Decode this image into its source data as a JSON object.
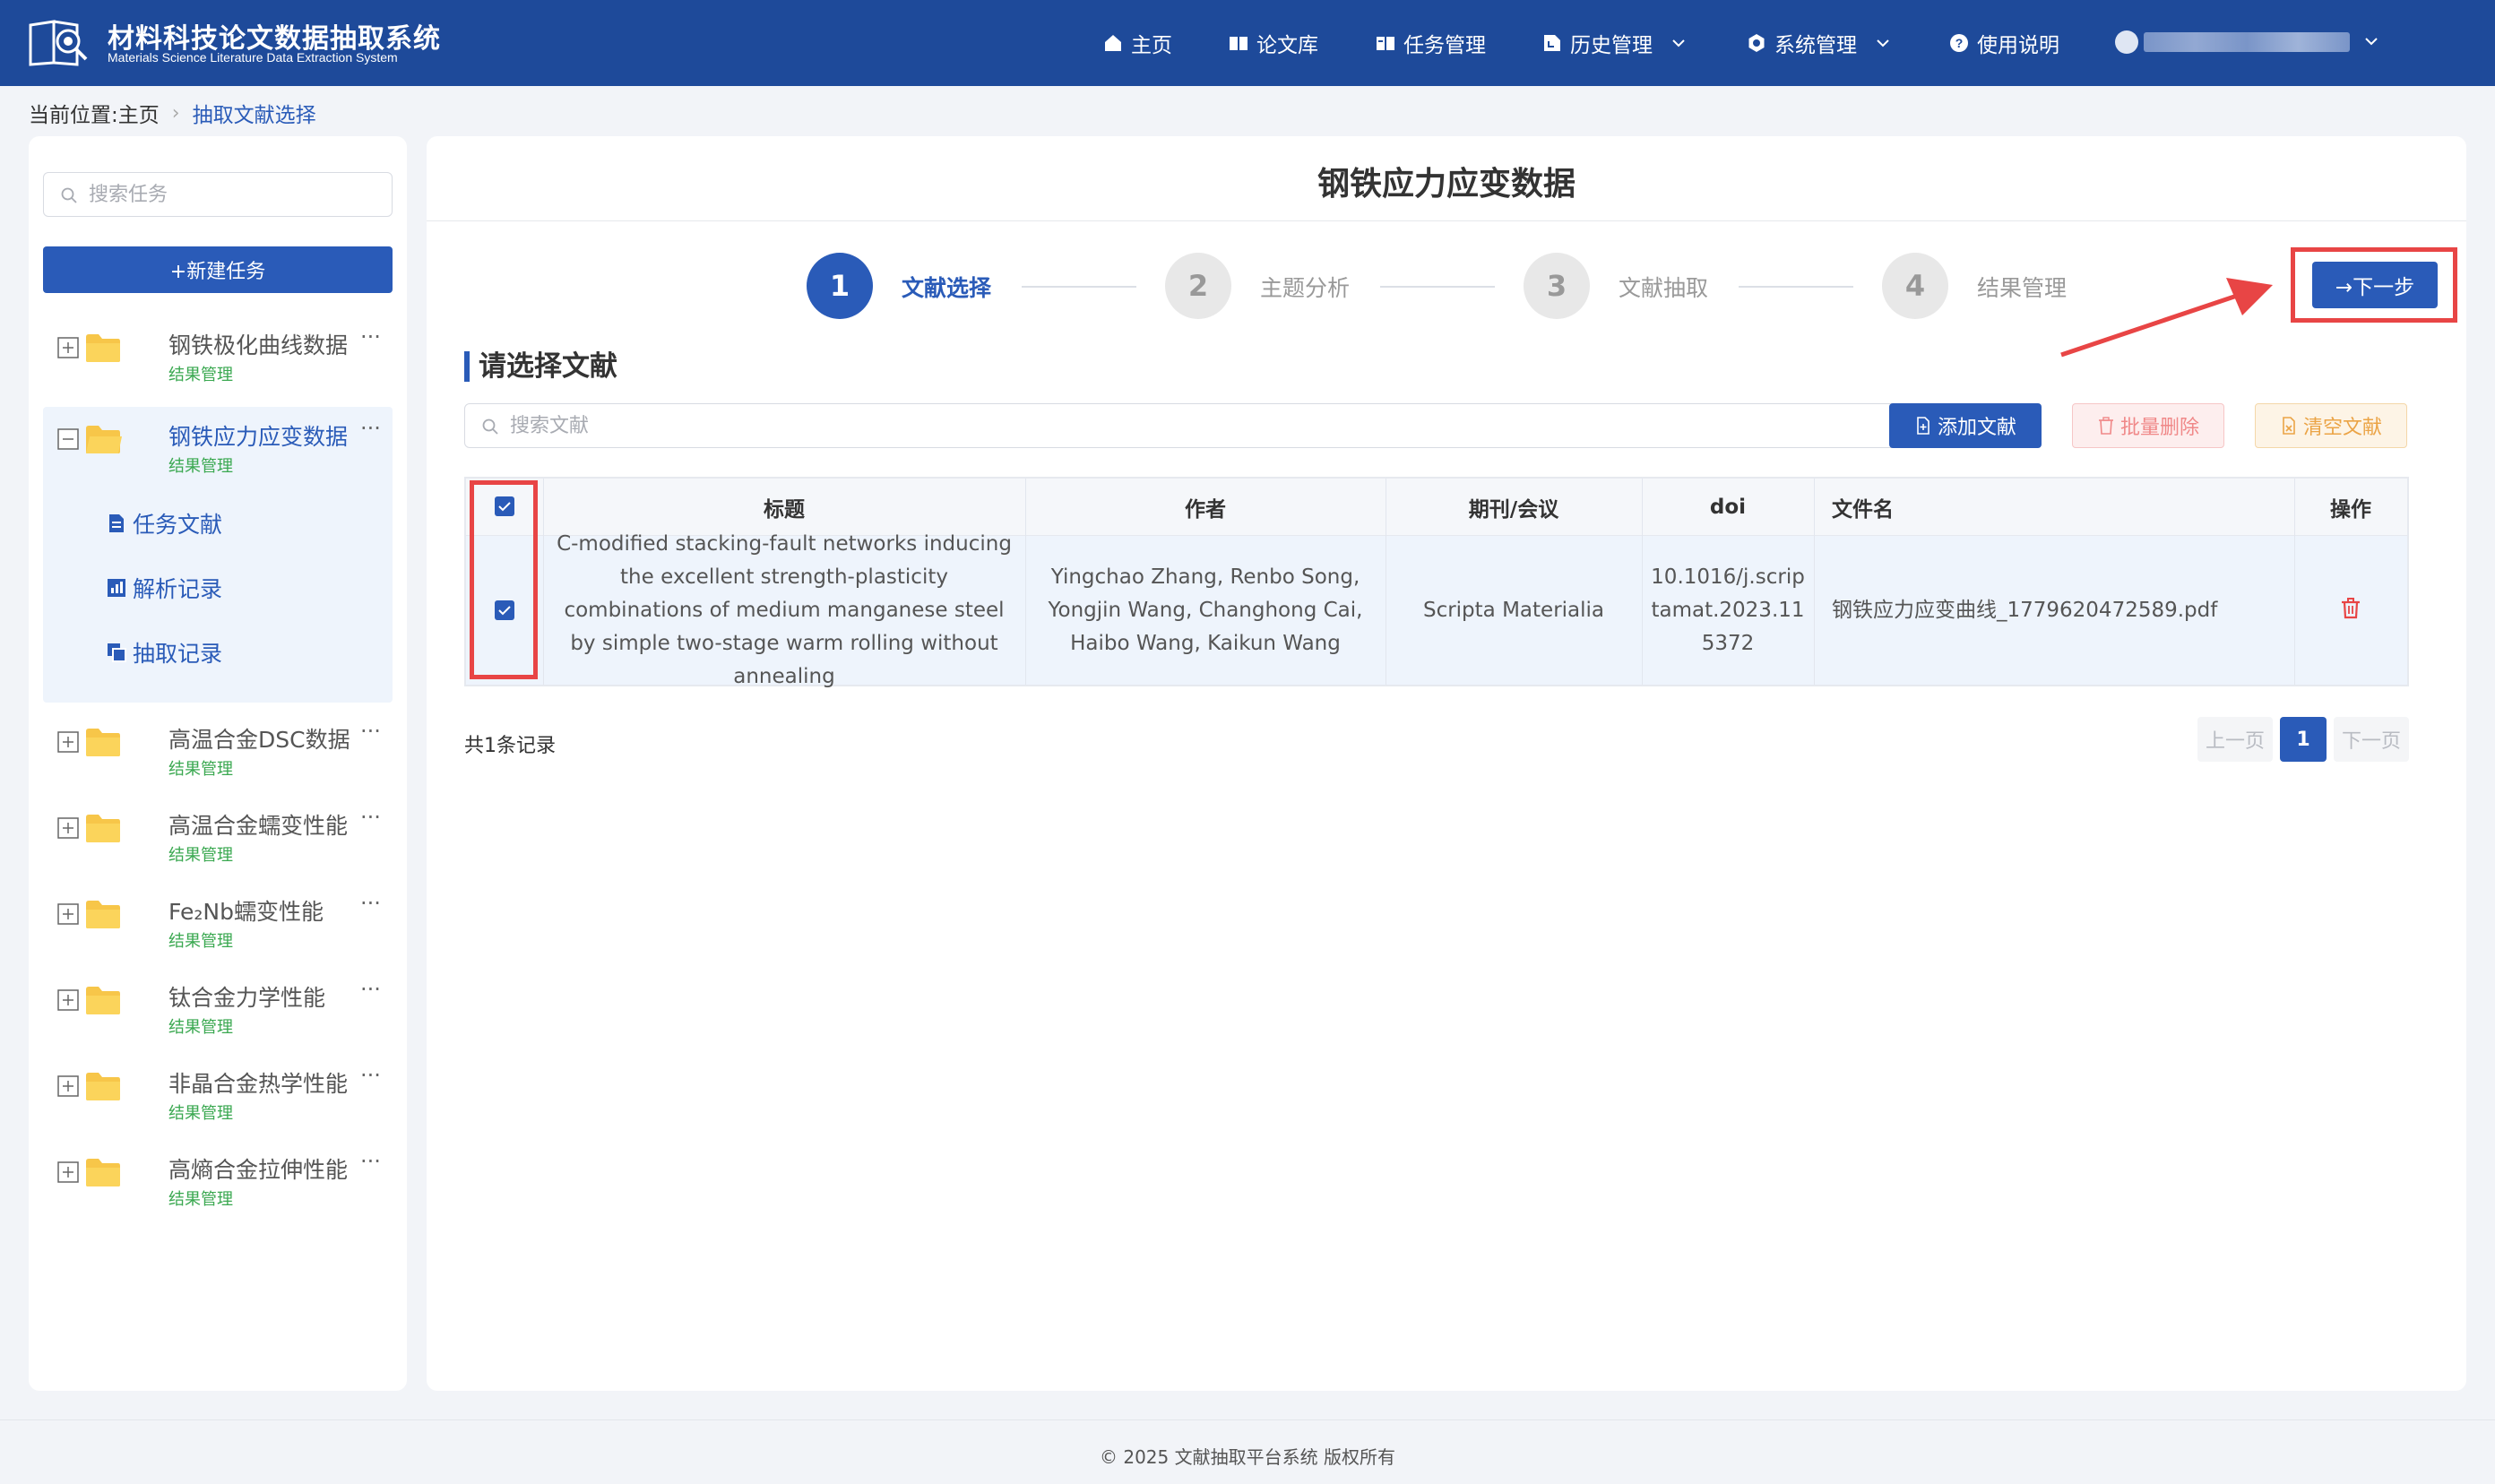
{
  "header": {
    "title": "材料科技论文数据抽取系统",
    "subtitle": "Materials Science Literature Data Extraction System",
    "nav": [
      {
        "label": "主页",
        "icon": "home-icon"
      },
      {
        "label": "论文库",
        "icon": "book-icon"
      },
      {
        "label": "任务管理",
        "icon": "task-icon"
      },
      {
        "label": "历史管理",
        "icon": "history-icon",
        "dropdown": true
      },
      {
        "label": "系统管理",
        "icon": "gear-icon",
        "dropdown": true
      },
      {
        "label": "使用说明",
        "icon": "help-icon"
      }
    ]
  },
  "breadcrumb": {
    "prefix": "当前位置:",
    "home": "主页",
    "current": "抽取文献选择"
  },
  "sidebar": {
    "search_placeholder": "搜索任务",
    "new_task_label": "+新建任务",
    "tasks": [
      {
        "name": "钢铁极化曲线数据",
        "status": "结果管理"
      },
      {
        "name": "钢铁应力应变数据",
        "status": "结果管理",
        "selected": true
      },
      {
        "name": "高温合金DSC数据",
        "status": "结果管理"
      },
      {
        "name": "高温合金蠕变性能",
        "status": "结果管理"
      },
      {
        "name": "Fe₂Nb蠕变性能",
        "status": "结果管理"
      },
      {
        "name": "钛合金力学性能",
        "status": "结果管理"
      },
      {
        "name": "非晶合金热学性能",
        "status": "结果管理"
      },
      {
        "name": "高熵合金拉伸性能",
        "status": "结果管理"
      }
    ],
    "sub_items": [
      {
        "label": "任务文献",
        "icon": "document-icon"
      },
      {
        "label": "解析记录",
        "icon": "chart-icon"
      },
      {
        "label": "抽取记录",
        "icon": "copy-icon"
      }
    ],
    "more": "···"
  },
  "main": {
    "title": "钢铁应力应变数据",
    "steps": [
      {
        "num": "1",
        "label": "文献选择",
        "active": true
      },
      {
        "num": "2",
        "label": "主题分析"
      },
      {
        "num": "3",
        "label": "文献抽取"
      },
      {
        "num": "4",
        "label": "结果管理"
      }
    ],
    "next_label": "→下一步",
    "section_title": "请选择文献",
    "doc_search_placeholder": "搜索文献",
    "buttons": {
      "add": "添加文献",
      "batch_delete": "批量删除",
      "clear": "清空文献"
    },
    "table": {
      "headers": [
        "标题",
        "作者",
        "期刊/会议",
        "doi",
        "文件名",
        "操作"
      ],
      "rows": [
        {
          "checked": true,
          "title": "C-modified stacking-fault networks inducing the excellent strength-plasticity combinations of medium manganese steel by simple two-stage warm rolling without annealing",
          "authors": "Yingchao Zhang, Renbo Song, Yongjin Wang, Changhong Cai, Haibo Wang, Kaikun Wang",
          "journal": "Scripta Materialia",
          "doi": "10.1016/j.scriptamat.2023.115372",
          "filename": "钢铁应力应变曲线_1779620472589.pdf"
        }
      ]
    },
    "total_text": "共1条记录",
    "pagination": {
      "prev": "上一页",
      "current": "1",
      "next": "下一页"
    }
  },
  "footer": "© 2025 文献抽取平台系统 版权所有",
  "colors": {
    "primary": "#2a5bb8",
    "header_bg": "#1e4a9a",
    "highlight": "#e84545",
    "status_green": "#3aa850"
  }
}
